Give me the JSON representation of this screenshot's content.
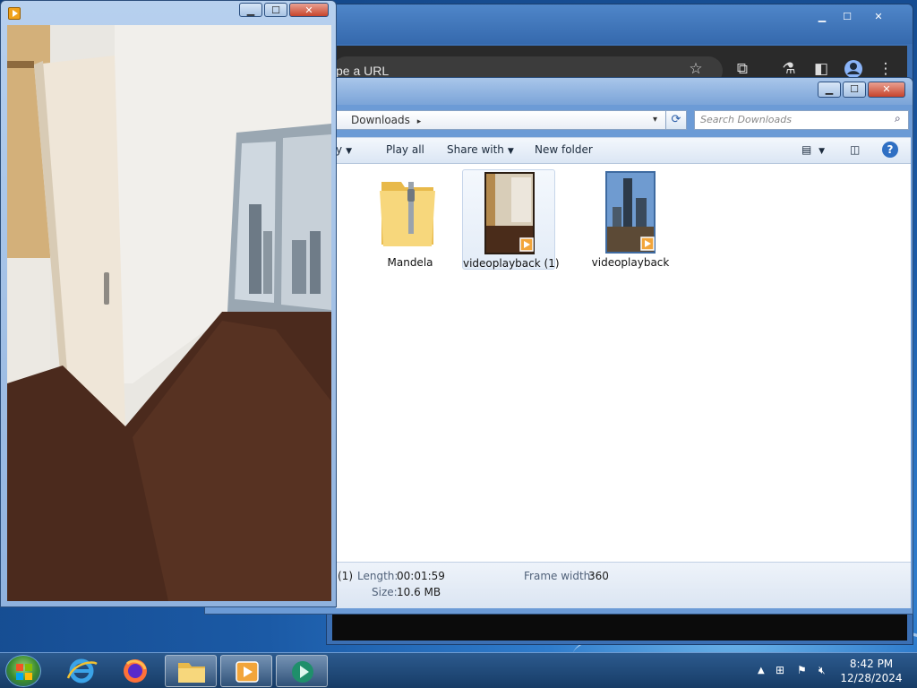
{
  "chrome": {
    "omnibox_text": "pe a URL",
    "icons": [
      "star-icon",
      "extensions-icon",
      "labs-icon",
      "side-panel-icon",
      "profile-icon",
      "menu-icon"
    ],
    "controls": {
      "minimize": "▁",
      "maximize": "☐",
      "close": "✕"
    }
  },
  "explorer": {
    "breadcrumb": "Downloads",
    "search_placeholder": "Search Downloads",
    "toolbar": {
      "organize_fragment": "y",
      "play_all": "Play all",
      "share_with": "Share with",
      "new_folder": "New folder"
    },
    "files": [
      {
        "name": "Mandela",
        "type": "zip-folder",
        "selected": false
      },
      {
        "name": "videoplayback (1)",
        "type": "video",
        "selected": true
      },
      {
        "name": "videoplayback",
        "type": "video",
        "selected": false
      }
    ],
    "details": {
      "name_fragment": "(1)",
      "length_label": "Length:",
      "length_value": "00:01:59",
      "size_label": "Size:",
      "size_value": "10.6 MB",
      "frame_width_label": "Frame width:",
      "frame_width_value": "360"
    },
    "controls": {
      "minimize": "▁",
      "maximize": "☐",
      "close": "✕"
    }
  },
  "player": {
    "controls": {
      "minimize": "▁",
      "maximize": "☐",
      "close": "✕"
    }
  },
  "taskbar": {
    "pinned": [
      "start-button",
      "internet-explorer",
      "firefox",
      "file-explorer",
      "media-player",
      "media-center"
    ],
    "active_index": 4,
    "tray": {
      "expand": "▲"
    },
    "clock": {
      "time": "8:42 PM",
      "date": "12/28/2024"
    }
  },
  "colors": {
    "accent": "#2f7ccc",
    "taskbar": "#173c66",
    "selection": "#e3ecf7"
  }
}
